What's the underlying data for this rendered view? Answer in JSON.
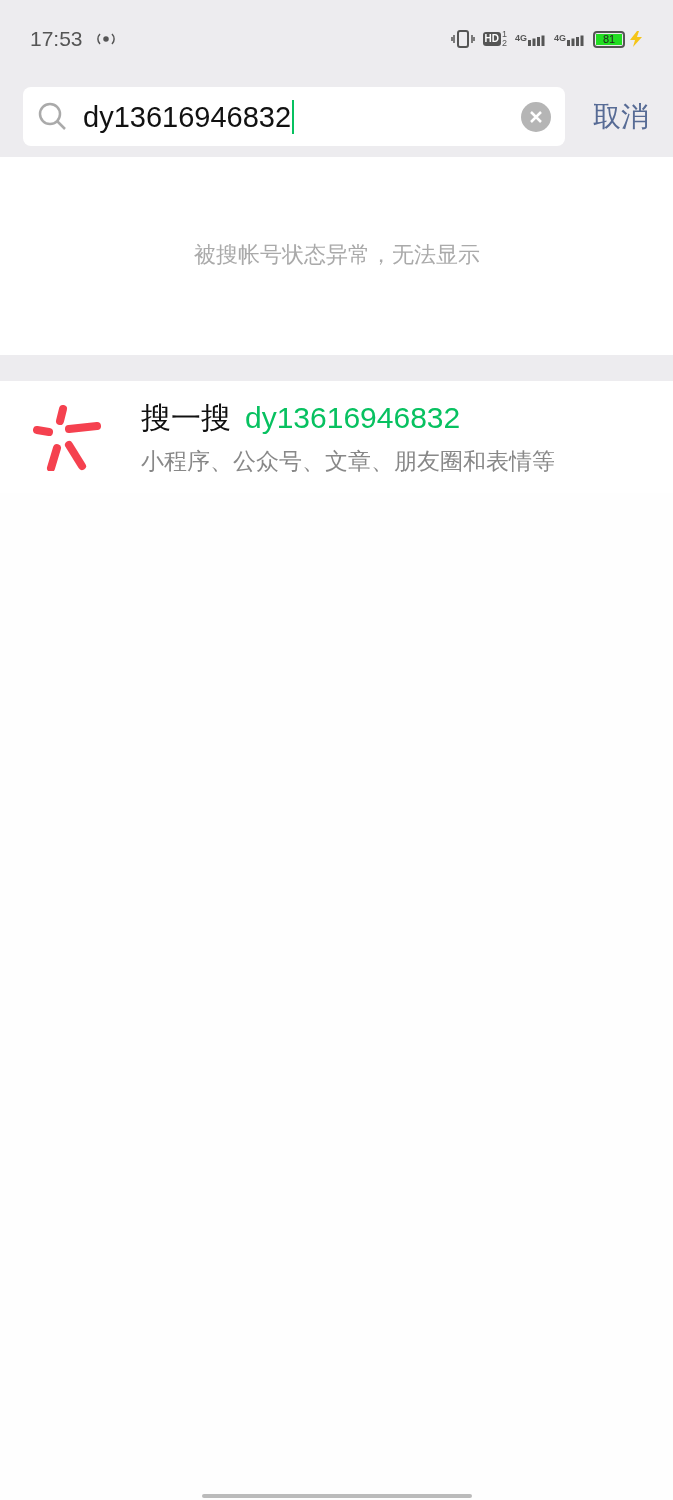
{
  "status_bar": {
    "time": "17:53",
    "hd": "HD",
    "sims": [
      "1",
      "2"
    ],
    "networks": [
      "4G",
      "4G"
    ],
    "battery": "81"
  },
  "search": {
    "value": "dy13616946832",
    "cancel": "取消"
  },
  "notice": "被搜帐号状态异常，无法显示",
  "search_suggestion": {
    "label": "搜一搜",
    "query": "dy13616946832",
    "subtitle": "小程序、公众号、文章、朋友圈和表情等"
  }
}
